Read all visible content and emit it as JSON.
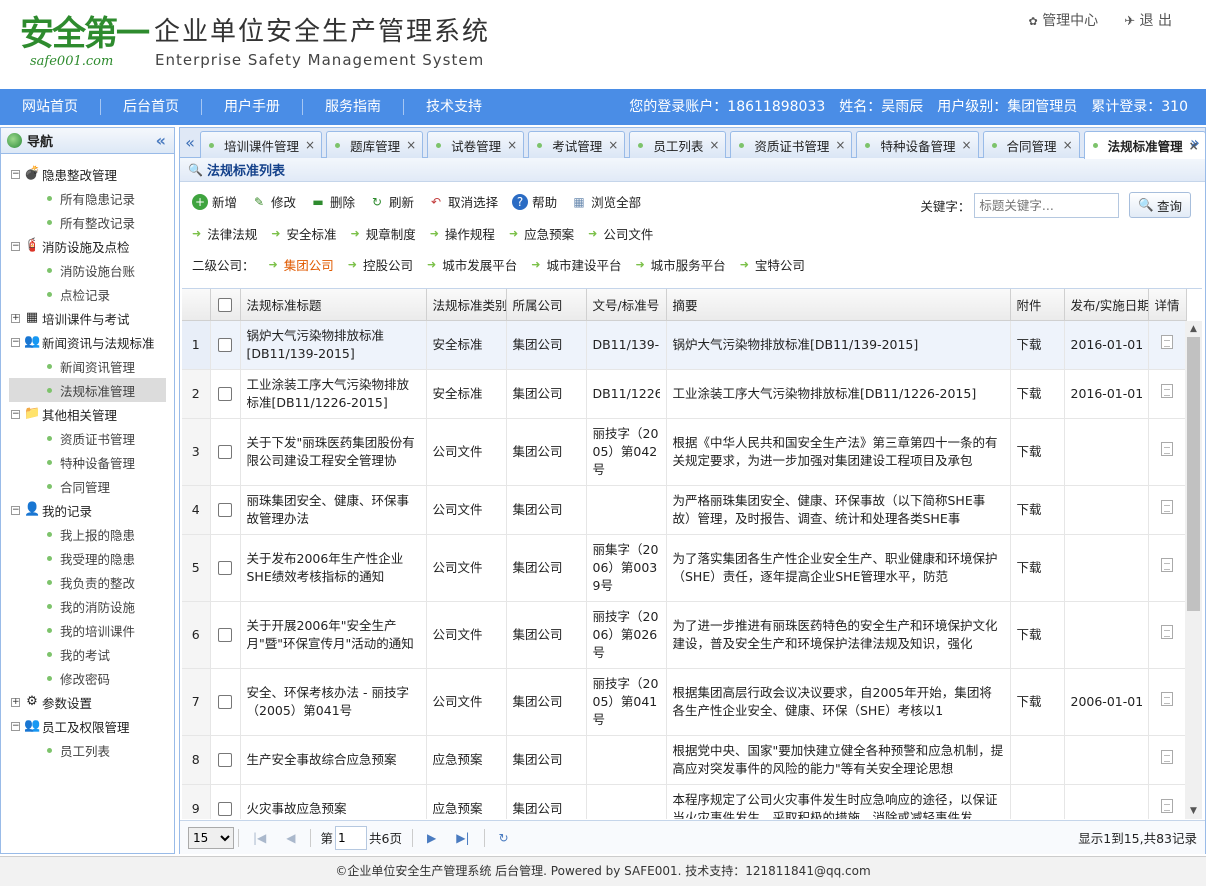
{
  "header": {
    "logo_main": "安全第一",
    "logo_sub": "safe001.com",
    "title": "企业单位安全生产管理系统",
    "subtitle": "Enterprise Safety Management System",
    "admin_center": "管理中心",
    "logout": "退 出"
  },
  "nav": {
    "items": [
      "网站首页",
      "后台首页",
      "用户手册",
      "服务指南",
      "技术支持"
    ],
    "account": "您的登录账户：18611898033",
    "name": "姓名：吴雨辰",
    "level": "用户级别：集团管理员",
    "logins": "累计登录：310"
  },
  "sidebar": {
    "title": "导航",
    "groups": [
      {
        "label": "隐患整改管理",
        "icon": "bomb-icon",
        "children": [
          "所有隐患记录",
          "所有整改记录"
        ]
      },
      {
        "label": "消防设施及点检",
        "icon": "fire-extinguisher-icon",
        "children": [
          "消防设施台账",
          "点检记录"
        ]
      },
      {
        "label": "培训课件与考试",
        "icon": "table-icon",
        "children": []
      },
      {
        "label": "新闻资讯与法规标准",
        "icon": "users-icon",
        "children": [
          "新闻资讯管理",
          "法规标准管理"
        ]
      },
      {
        "label": "其他相关管理",
        "icon": "folder-icon",
        "children": [
          "资质证书管理",
          "特种设备管理",
          "合同管理"
        ]
      },
      {
        "label": "我的记录",
        "icon": "user-icon",
        "children": [
          "我上报的隐患",
          "我受理的隐患",
          "我负责的整改",
          "我的消防设施",
          "我的培训课件",
          "我的考试",
          "修改密码"
        ]
      },
      {
        "label": "参数设置",
        "icon": "gear-icon",
        "children": []
      },
      {
        "label": "员工及权限管理",
        "icon": "people-icon",
        "children": [
          "员工列表"
        ]
      }
    ],
    "selected": "法规标准管理"
  },
  "tabs": [
    "培训课件管理",
    "题库管理",
    "试卷管理",
    "考试管理",
    "员工列表",
    "资质证书管理",
    "特种设备管理",
    "合同管理",
    "法规标准管理"
  ],
  "active_tab": "法规标准管理",
  "panel_title": "法规标准列表",
  "toolbar": {
    "buttons": [
      "新增",
      "修改",
      "删除",
      "刷新",
      "取消选择",
      "帮助",
      "浏览全部"
    ],
    "categories": [
      "法律法规",
      "安全标准",
      "规章制度",
      "操作规程",
      "应急预案",
      "公司文件"
    ],
    "sub_label": "二级公司：",
    "companies": [
      "集团公司",
      "控股公司",
      "城市发展平台",
      "城市建设平台",
      "城市服务平台",
      "宝特公司"
    ],
    "active_company": "集团公司",
    "keyword_label": "关键字：",
    "keyword_placeholder": "标题关键字...",
    "search_label": "查询"
  },
  "table": {
    "columns": [
      "法规标准标题",
      "法规标准类别",
      "所属公司",
      "文号/标准号",
      "摘要",
      "附件",
      "发布/实施日期",
      "详情"
    ],
    "rows": [
      {
        "n": "1",
        "title": "锅炉大气污染物排放标准[DB11/139-2015]",
        "cat": "安全标准",
        "co": "集团公司",
        "no": "DB11/139-20",
        "sum": "锅炉大气污染物排放标准[DB11/139-2015]",
        "att": "下载",
        "date": "2016-01-01"
      },
      {
        "n": "2",
        "title": "工业涂装工序大气污染物排放标准[DB11/1226-2015]",
        "cat": "安全标准",
        "co": "集团公司",
        "no": "DB11/1226-2",
        "sum": "工业涂装工序大气污染物排放标准[DB11/1226-2015]",
        "att": "下载",
        "date": "2016-01-01"
      },
      {
        "n": "3",
        "title": "关于下发\"丽珠医药集团股份有限公司建设工程安全管理协议\"的通知",
        "cat": "公司文件",
        "co": "集团公司",
        "no": "丽技字（2005）第042号",
        "sum": "根据《中华人民共和国安全生产法》第三章第四十一条的有关规定要求，为进一步加强对集团建设工程项目及承包",
        "att": "下载",
        "date": ""
      },
      {
        "n": "4",
        "title": "丽珠集团安全、健康、环保事故管理办法",
        "cat": "公司文件",
        "co": "集团公司",
        "no": "",
        "sum": "为严格丽珠集团安全、健康、环保事故（以下简称SHE事故）管理，及时报告、调查、统计和处理各类SHE事",
        "att": "下载",
        "date": ""
      },
      {
        "n": "5",
        "title": "关于发布2006年生产性企业SHE绩效考核指标的通知",
        "cat": "公司文件",
        "co": "集团公司",
        "no": "丽集字（2006）第0039号",
        "sum": "为了落实集团各生产性企业安全生产、职业健康和环境保护（SHE）责任，逐年提高企业SHE管理水平，防范",
        "att": "下载",
        "date": ""
      },
      {
        "n": "6",
        "title": "关于开展2006年\"安全生产月\"暨\"环保宣传月\"活动的通知",
        "cat": "公司文件",
        "co": "集团公司",
        "no": "丽技字（2006）第026号",
        "sum": "为了进一步推进有丽珠医药特色的安全生产和环境保护文化建设，普及安全生产和环境保护法律法规及知识，强化",
        "att": "下载",
        "date": ""
      },
      {
        "n": "7",
        "title": "安全、环保考核办法 - 丽技字（2005）第041号",
        "cat": "公司文件",
        "co": "集团公司",
        "no": "丽技字（2005）第041号",
        "sum": "根据集团高层行政会议决议要求，自2005年开始，集团将各生产性企业安全、健康、环保（SHE）考核以1",
        "att": "下载",
        "date": "2006-01-01"
      },
      {
        "n": "8",
        "title": "生产安全事故综合应急预案",
        "cat": "应急预案",
        "co": "集团公司",
        "no": "",
        "sum": "根据党中央、国家\"要加快建立健全各种预警和应急机制，提高应对突发事件的风险的能力\"等有关安全理论思想",
        "att": "",
        "date": ""
      },
      {
        "n": "9",
        "title": "火灾事故应急预案",
        "cat": "应急预案",
        "co": "集团公司",
        "no": "",
        "sum": "本程序规定了公司火灾事件发生时应急响应的途径，以保证当火灾事件发生，采取积极的措施，消除或减轻事件发",
        "att": "",
        "date": ""
      }
    ]
  },
  "pager": {
    "page_size": "15",
    "page_label": "第",
    "page_value": "1",
    "total_pages": "共6页",
    "summary": "显示1到15,共83记录"
  },
  "footer": "©企业单位安全生产管理系统 后台管理. Powered by SAFE001.   技术支持：121811841@qq.com"
}
